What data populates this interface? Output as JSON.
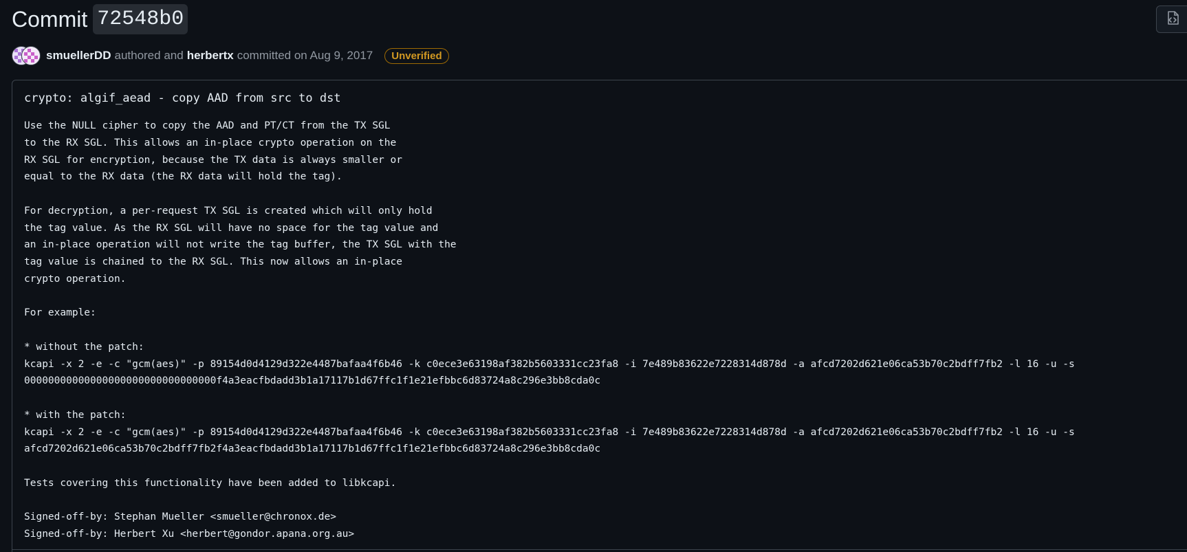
{
  "header": {
    "title_word": "Commit",
    "sha": "72548b0"
  },
  "meta": {
    "author": "smuellerDD",
    "authored_text": "authored and",
    "committer": "herbertx",
    "committed_text": "committed on Aug 9, 2017",
    "badge": "Unverified"
  },
  "toolbar": {
    "browse_icon": "code-file-icon"
  },
  "commit": {
    "title": "crypto: algif_aead - copy AAD from src to dst",
    "description": "Use the NULL cipher to copy the AAD and PT/CT from the TX SGL\nto the RX SGL. This allows an in-place crypto operation on the\nRX SGL for encryption, because the TX data is always smaller or\nequal to the RX data (the RX data will hold the tag).\n\nFor decryption, a per-request TX SGL is created which will only hold\nthe tag value. As the RX SGL will have no space for the tag value and\nan in-place operation will not write the tag buffer, the TX SGL with the\ntag value is chained to the RX SGL. This now allows an in-place\ncrypto operation.\n\nFor example:\n\n* without the patch:\nkcapi -x 2 -e -c \"gcm(aes)\" -p 89154d0d4129d322e4487bafaa4f6b46 -k c0ece3e63198af382b5603331cc23fa8 -i 7e489b83622e7228314d878d -a afcd7202d621e06ca53b70c2bdff7fb2 -l 16 -u -s\n00000000000000000000000000000000f4a3eacfbdadd3b1a17117b1d67ffc1f1e21efbbc6d83724a8c296e3bb8cda0c\n\n* with the patch:\nkcapi -x 2 -e -c \"gcm(aes)\" -p 89154d0d4129d322e4487bafaa4f6b46 -k c0ece3e63198af382b5603331cc23fa8 -i 7e489b83622e7228314d878d -a afcd7202d621e06ca53b70c2bdff7fb2 -l 16 -u -s\nafcd7202d621e06ca53b70c2bdff7fb2f4a3eacfbdadd3b1a17117b1d67ffc1f1e21efbbc6d83724a8c296e3bb8cda0c\n\nTests covering this functionality have been added to libkcapi.\n\nSigned-off-by: Stephan Mueller <smueller@chronox.de>\nSigned-off-by: Herbert Xu <herbert@gondor.apana.org.au>"
  },
  "colors": {
    "background": "#0d1117",
    "text": "#e6edf3",
    "muted": "#9198a1",
    "border": "#3d444d",
    "warning": "#d29922"
  }
}
